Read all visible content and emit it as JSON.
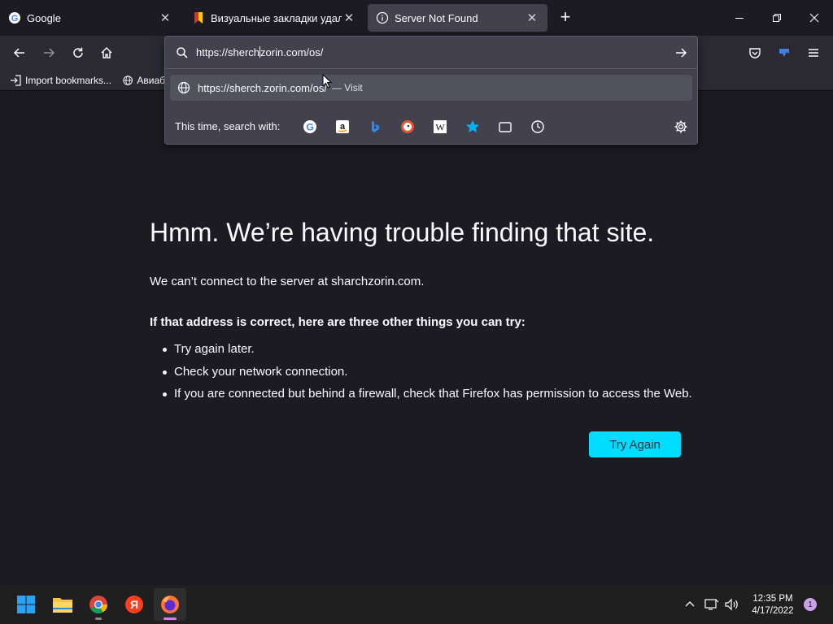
{
  "tabs": [
    {
      "label": "Google",
      "icon": "google-icon"
    },
    {
      "label": "Визуальные закладки удалены",
      "icon": "bookmark-flag-icon"
    },
    {
      "label": "Server Not Found",
      "icon": "info-icon"
    }
  ],
  "url_bar": {
    "value_before_caret": "https://sherch",
    "value_after_caret": "zorin.com/os/"
  },
  "suggestion": {
    "url": "https://sherch.zorin.com/os/",
    "action": "— Visit"
  },
  "search_with_label": "This time, search with:",
  "bookmarks": [
    {
      "label": "Import bookmarks..."
    },
    {
      "label": "Авиаб"
    }
  ],
  "error_page": {
    "title": "Hmm. We’re having trouble finding that site.",
    "message": "We can’t connect to the server at sharchzorin.com.",
    "tips_heading": "If that address is correct, here are three other things you can try:",
    "tips": [
      "Try again later.",
      "Check your network connection.",
      "If you are connected but behind a firewall, check that Firefox has permission to access the Web."
    ],
    "button_label": "Try Again"
  },
  "taskbar": {
    "time": "12:35 PM",
    "date": "4/17/2022",
    "notification_count": "1",
    "apps": [
      "start-icon",
      "file-explorer-icon",
      "chrome-icon",
      "yandex-icon",
      "firefox-icon"
    ]
  },
  "colors": {
    "accent": "#00ddff",
    "page_bg": "#1c1b22",
    "toolbar_bg": "#2b2a33"
  }
}
